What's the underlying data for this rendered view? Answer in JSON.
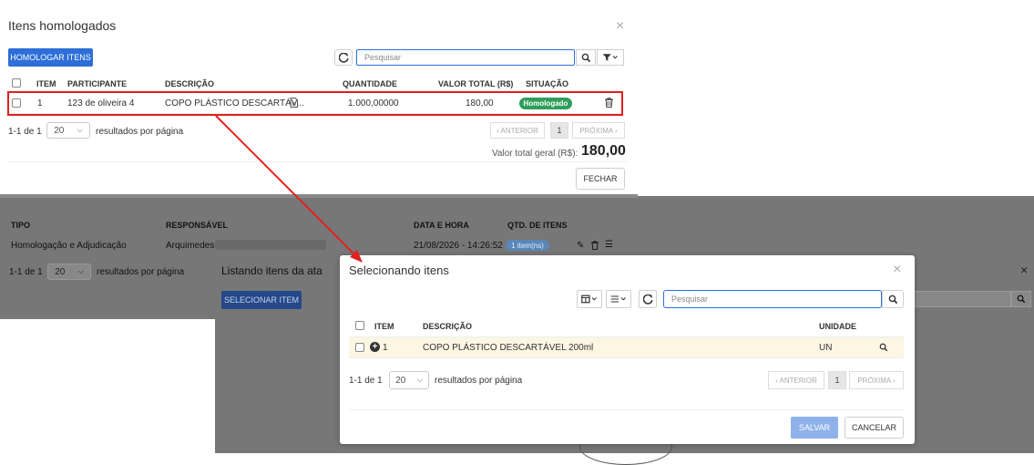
{
  "top_dialog": {
    "title": "Itens homologados",
    "close": "×",
    "homologar_btn": "HOMOLOGAR ITENS",
    "search_placeholder": "Pesquisar",
    "columns": [
      "ITEM",
      "PARTICIPANTE",
      "DESCRIÇÃO",
      "QUANTIDADE",
      "VALOR TOTAL (R$)",
      "SITUAÇÃO"
    ],
    "row": {
      "item": "1",
      "participante": "123 de oliveira 4",
      "descricao": "COPO PLÁSTICO DESCARTÁV...",
      "quantidade": "1.000,00000",
      "valor": "180,00",
      "situacao": "Homologado"
    },
    "range": "1-1 de 1",
    "page_size": "20",
    "per_page_label": "resultados por página",
    "prev": "‹ ANTERIOR",
    "page": "1",
    "next": "PRÓXIMA ›",
    "total_label": "Valor total geral (R$):",
    "total_value": "180,00",
    "fechar": "FECHAR"
  },
  "background": {
    "columns": [
      "TIPO",
      "RESPONSÁVEL",
      "DATA E HORA",
      "QTD. DE ITENS"
    ],
    "row": {
      "tipo": "Homologação e Adjudicação",
      "responsavel": "Arquimedes",
      "data": "21/08/2026 - 14:26:52",
      "qtd": "1 item(ns)"
    },
    "range": "1-1 de 1",
    "page_size": "20",
    "per_page_label": "resultados por página",
    "listing_title": "Listando itens da ata",
    "selecionar_btn": "SELECIONAR ITEM"
  },
  "bottom_dialog": {
    "title": "Selecionando itens",
    "close": "×",
    "search_placeholder": "Pesquisar",
    "columns": [
      "ITEM",
      "DESCRIÇÃO",
      "UNIDADE"
    ],
    "row": {
      "item": "1",
      "descricao": "COPO PLÁSTICO DESCARTÁVEL 200ml",
      "unidade": "UN"
    },
    "range": "1-1 de 1",
    "page_size": "20",
    "per_page_label": "resultados por página",
    "prev": "‹ ANTERIOR",
    "page": "1",
    "next": "PRÓXIMA ›",
    "salvar": "SALVAR",
    "cancelar": "CANCELAR"
  },
  "colors": {
    "accent": "#2d6fd8",
    "badge_green": "#2e9e5b",
    "highlight_red": "#e02020",
    "row_highlight": "#fdf6e3"
  }
}
